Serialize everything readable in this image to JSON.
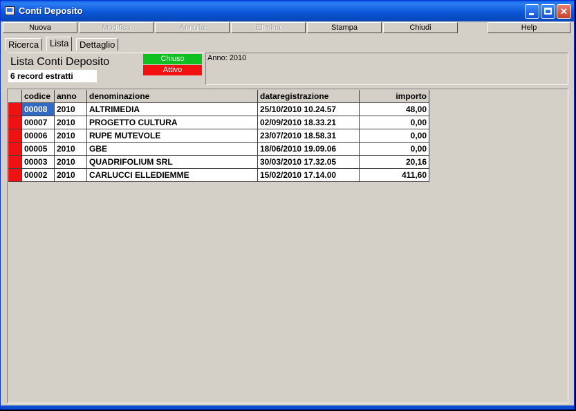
{
  "window": {
    "title": "Conti Deposito"
  },
  "toolbar": {
    "buttons": [
      {
        "label": "Nuova",
        "enabled": true
      },
      {
        "label": "Modifica",
        "enabled": false
      },
      {
        "label": "Annulla",
        "enabled": false
      },
      {
        "label": "Elimina",
        "enabled": false
      },
      {
        "label": "Stampa",
        "enabled": true
      },
      {
        "label": "Chiudi",
        "enabled": true
      },
      {
        "label": "Help",
        "enabled": true
      }
    ]
  },
  "tabs": [
    {
      "label": "Ricerca",
      "active": false
    },
    {
      "label": "Lista",
      "active": true
    },
    {
      "label": "Dettaglio",
      "active": false
    }
  ],
  "header": {
    "title": "Lista Conti Deposito",
    "record_count": "6 record estratti",
    "legend": {
      "chiuso": {
        "label": "Chiuso",
        "color": "#0fbf1f"
      },
      "attivo": {
        "label": "Attivo",
        "color": "#f21010"
      }
    },
    "info": "Anno: 2010"
  },
  "grid": {
    "columns": [
      "codice",
      "anno",
      "denominazione",
      "dataregistrazione",
      "importo"
    ],
    "rows": [
      [
        "00008",
        "2010",
        "ALTRIMEDIA",
        "25/10/2010 10.24.57",
        "48,00"
      ],
      [
        "00007",
        "2010",
        "PROGETTO CULTURA",
        "02/09/2010 18.33.21",
        "0,00"
      ],
      [
        "00006",
        "2010",
        "RUPE MUTEVOLE",
        "23/07/2010 18.58.31",
        "0,00"
      ],
      [
        "00005",
        "2010",
        "GBE",
        "18/06/2010 19.09.06",
        "0,00"
      ],
      [
        "00003",
        "2010",
        "QUADRIFOLIUM SRL",
        "30/03/2010 17.32.05",
        "20,16"
      ],
      [
        "00002",
        "2010",
        "CARLUCCI ELLEDIEMME",
        "15/02/2010 17.14.00",
        "411,60"
      ]
    ],
    "selected_row": 0
  }
}
